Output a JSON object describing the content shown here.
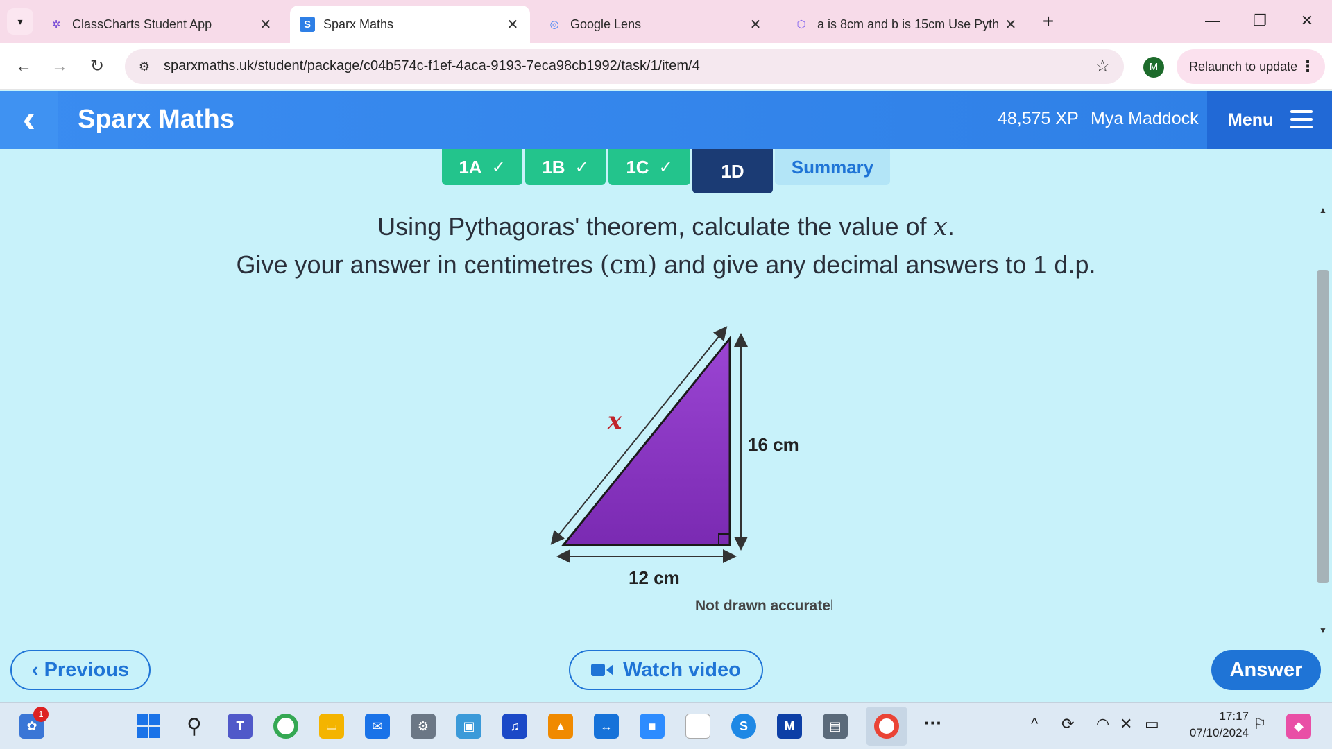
{
  "browser": {
    "tabs": [
      {
        "title": "ClassCharts Student App",
        "favicon": "sparkle-icon"
      },
      {
        "title": "Sparx Maths",
        "favicon": "S",
        "active": true
      },
      {
        "title": "Google Lens",
        "favicon": "lens-icon"
      },
      {
        "title": "a is 8cm and b is 15cm Use Pyth",
        "favicon": "cube-icon"
      }
    ],
    "url": "sparxmaths.uk/student/package/c04b574c-f1ef-4aca-9193-7eca98cb1992/task/1/item/4",
    "profile_initial": "M",
    "relaunch_label": "Relaunch to update"
  },
  "header": {
    "brand": "Sparx Maths",
    "xp": "48,575 XP",
    "user": "Mya Maddock",
    "menu_label": "Menu"
  },
  "task_tabs": [
    {
      "label": "1A",
      "status": "done"
    },
    {
      "label": "1B",
      "status": "done"
    },
    {
      "label": "1C",
      "status": "done"
    },
    {
      "label": "1D",
      "status": "current"
    },
    {
      "label": "Summary",
      "status": "summary"
    }
  ],
  "question": {
    "line1_pre": "Using Pythagoras' theorem, calculate the value of ",
    "line1_var": "x",
    "line1_post": ".",
    "line2_pre": "Give your answer in centimetres ",
    "line2_unit": "(cm)",
    "line2_post": " and give any decimal answers to 1 d.p."
  },
  "diagram": {
    "hypotenuse_label": "x",
    "height_label": "16 cm",
    "base_label": "12 cm",
    "note": "Not drawn accurately",
    "fill_color": "#8a2ec4"
  },
  "buttons": {
    "previous": "Previous",
    "watch_video": "Watch video",
    "answer": "Answer"
  },
  "taskbar": {
    "notification_count": "1",
    "time": "17:17",
    "date": "07/10/2024",
    "more": "···"
  }
}
